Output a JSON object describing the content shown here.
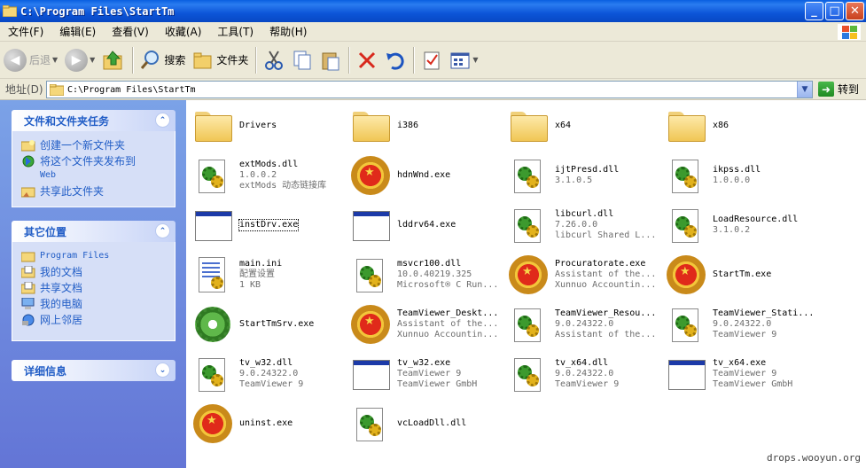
{
  "window": {
    "title": "C:\\Program Files\\StartTm"
  },
  "menubar": {
    "items": [
      "文件(F)",
      "编辑(E)",
      "查看(V)",
      "收藏(A)",
      "工具(T)",
      "帮助(H)"
    ]
  },
  "toolbar": {
    "back": "后退",
    "search": "搜索",
    "folders": "文件夹"
  },
  "address": {
    "label": "地址(D)",
    "value": "C:\\Program Files\\StartTm",
    "go": "转到"
  },
  "tasks": {
    "title": "文件和文件夹任务",
    "items": [
      "创建一个新文件夹",
      "将这个文件夹发布到",
      "Web",
      "共享此文件夹"
    ]
  },
  "places": {
    "title": "其它位置",
    "items": [
      "Program Files",
      "我的文档",
      "共享文档",
      "我的电脑",
      "网上邻居"
    ]
  },
  "details": {
    "title": "详细信息"
  },
  "files": [
    {
      "name": "Drivers",
      "line2": "",
      "line3": "",
      "icon": "folder-icon"
    },
    {
      "name": "i386",
      "line2": "",
      "line3": "",
      "icon": "folder-icon"
    },
    {
      "name": "x64",
      "line2": "",
      "line3": "",
      "icon": "folder-icon"
    },
    {
      "name": "x86",
      "line2": "",
      "line3": "",
      "icon": "folder-icon"
    },
    {
      "name": "extMods.dll",
      "line2": "1.0.0.2",
      "line3": "extMods 动态链接库",
      "icon": "dll-icon"
    },
    {
      "name": "hdnWnd.exe",
      "line2": "",
      "line3": "",
      "icon": "emblem-icon"
    },
    {
      "name": "ijtPresd.dll",
      "line2": "3.1.0.5",
      "line3": "",
      "icon": "dll-icon"
    },
    {
      "name": "ikpss.dll",
      "line2": "1.0.0.0",
      "line3": "",
      "icon": "dll-icon"
    },
    {
      "name": "instDrv.exe",
      "line2": "",
      "line3": "",
      "icon": "window-icon"
    },
    {
      "name": "lddrv64.exe",
      "line2": "",
      "line3": "",
      "icon": "window-icon"
    },
    {
      "name": "libcurl.dll",
      "line2": "7.26.0.0",
      "line3": "libcurl Shared L...",
      "icon": "dll-icon"
    },
    {
      "name": "LoadResource.dll",
      "line2": "3.1.0.2",
      "line3": "",
      "icon": "dll-icon"
    },
    {
      "name": "main.ini",
      "line2": "配置设置",
      "line3": "1 KB",
      "icon": "ini-icon"
    },
    {
      "name": "msvcr100.dll",
      "line2": "10.0.40219.325",
      "line3": "Microsoft® C Run...",
      "icon": "dll-icon"
    },
    {
      "name": "Procuratorate.exe",
      "line2": "Assistant of the...",
      "line3": "Xunnuo Accountin...",
      "icon": "emblem-icon"
    },
    {
      "name": "StartTm.exe",
      "line2": "",
      "line3": "",
      "icon": "emblem-icon"
    },
    {
      "name": "StartTmSrv.exe",
      "line2": "",
      "line3": "",
      "icon": "gear-icon"
    },
    {
      "name": "TeamViewer_Deskt...",
      "line2": "Assistant of the...",
      "line3": "Xunnuo Accountin...",
      "icon": "emblem-icon"
    },
    {
      "name": "TeamViewer_Resou...",
      "line2": "9.0.24322.0",
      "line3": "Assistant of the...",
      "icon": "dll-icon"
    },
    {
      "name": "TeamViewer_Stati...",
      "line2": "9.0.24322.0",
      "line3": "TeamViewer 9",
      "icon": "dll-icon"
    },
    {
      "name": "tv_w32.dll",
      "line2": "9.0.24322.0",
      "line3": "TeamViewer 9",
      "icon": "dll-icon"
    },
    {
      "name": "tv_w32.exe",
      "line2": "TeamViewer 9",
      "line3": "TeamViewer GmbH",
      "icon": "window-icon"
    },
    {
      "name": "tv_x64.dll",
      "line2": "9.0.24322.0",
      "line3": "TeamViewer 9",
      "icon": "dll-icon"
    },
    {
      "name": "tv_x64.exe",
      "line2": "TeamViewer 9",
      "line3": "TeamViewer GmbH",
      "icon": "window-icon"
    },
    {
      "name": "uninst.exe",
      "line2": "",
      "line3": "",
      "icon": "emblem-icon"
    },
    {
      "name": "vcLoadDll.dll",
      "line2": "",
      "line3": "",
      "icon": "dll-icon"
    }
  ],
  "watermark": "drops.wooyun.org"
}
